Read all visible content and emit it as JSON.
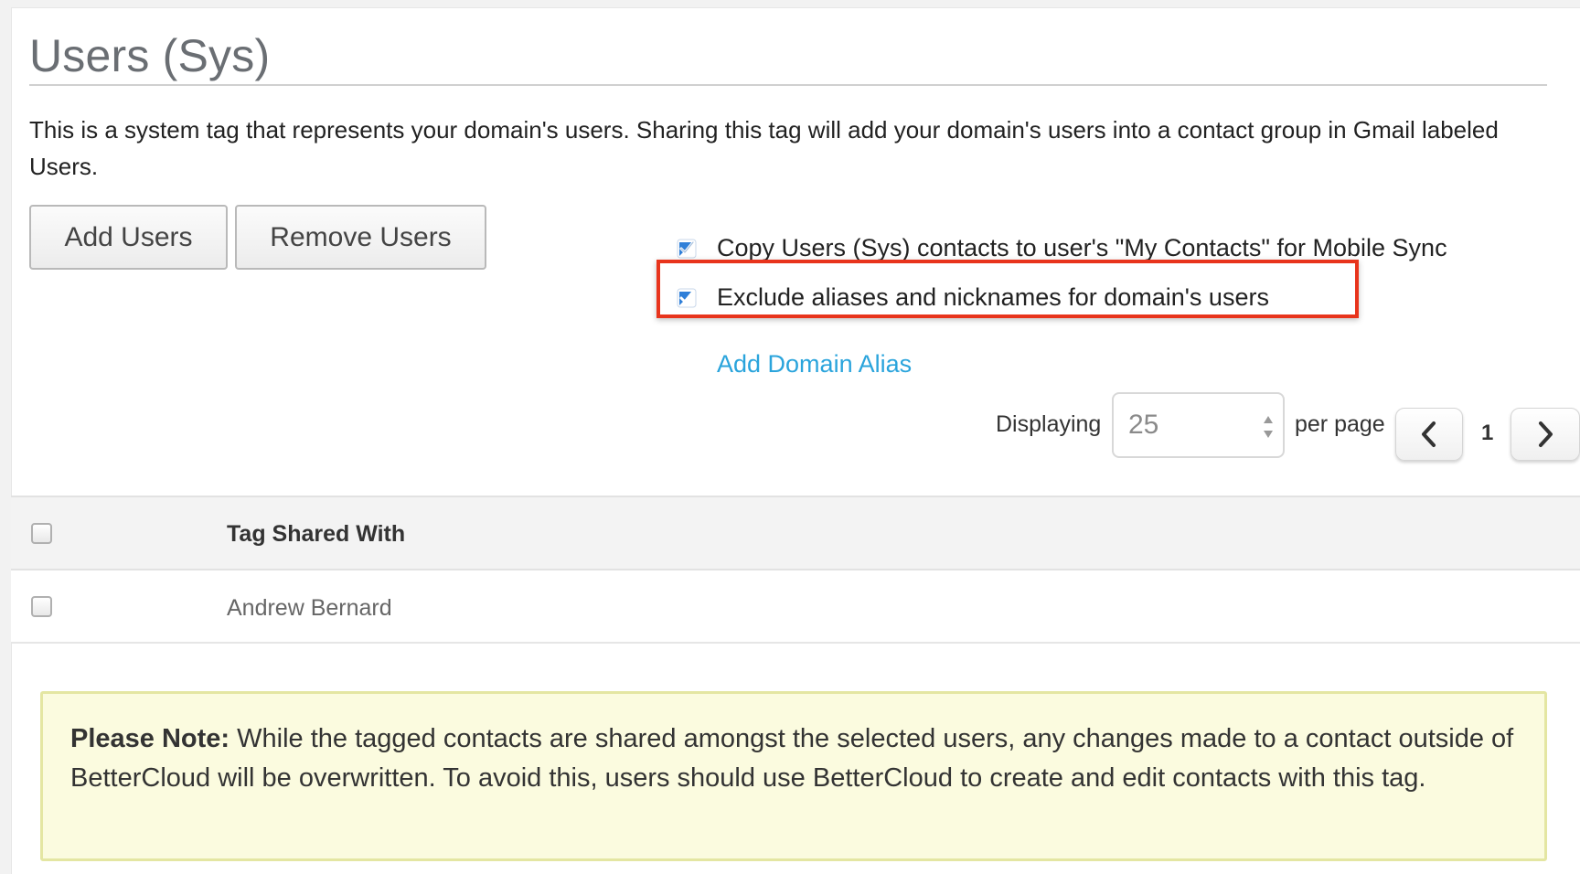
{
  "page": {
    "title": "Users (Sys)",
    "description": "This is a system tag that represents your domain's users. Sharing this tag will add your domain's users into a contact group in Gmail labeled Users."
  },
  "actions": {
    "add_users_label": "Add Users",
    "remove_users_label": "Remove Users"
  },
  "options": {
    "copy_contacts": {
      "label": "Copy Users (Sys) contacts to user's \"My Contacts\" for Mobile Sync",
      "checked": true
    },
    "exclude_aliases": {
      "label": "Exclude aliases and nicknames for domain's users",
      "checked": true
    },
    "add_domain_alias_label": "Add Domain Alias"
  },
  "pagination": {
    "displaying_label": "Displaying",
    "per_page_value": "25",
    "per_page_label": "per page",
    "current_page": "1"
  },
  "table": {
    "header": "Tag Shared With",
    "rows": [
      {
        "name": "Andrew Bernard",
        "checked": false
      }
    ]
  },
  "note": {
    "label": "Please Note:",
    "text": " While the tagged contacts are shared amongst the selected users, any changes made to a contact outside of BetterCloud will be overwritten. To avoid this, users should use BetterCloud to create and edit contacts with this tag."
  },
  "colors": {
    "link": "#2aa4dc",
    "highlight_border": "#e8341c",
    "checkbox_checked": "#2f7fd8",
    "note_background": "#fbfbdf"
  },
  "icons": {
    "checkbox": "checkbox-checked-icon",
    "prev": "chevron-left-icon",
    "next": "chevron-right-icon",
    "select": "select-arrows-icon"
  }
}
